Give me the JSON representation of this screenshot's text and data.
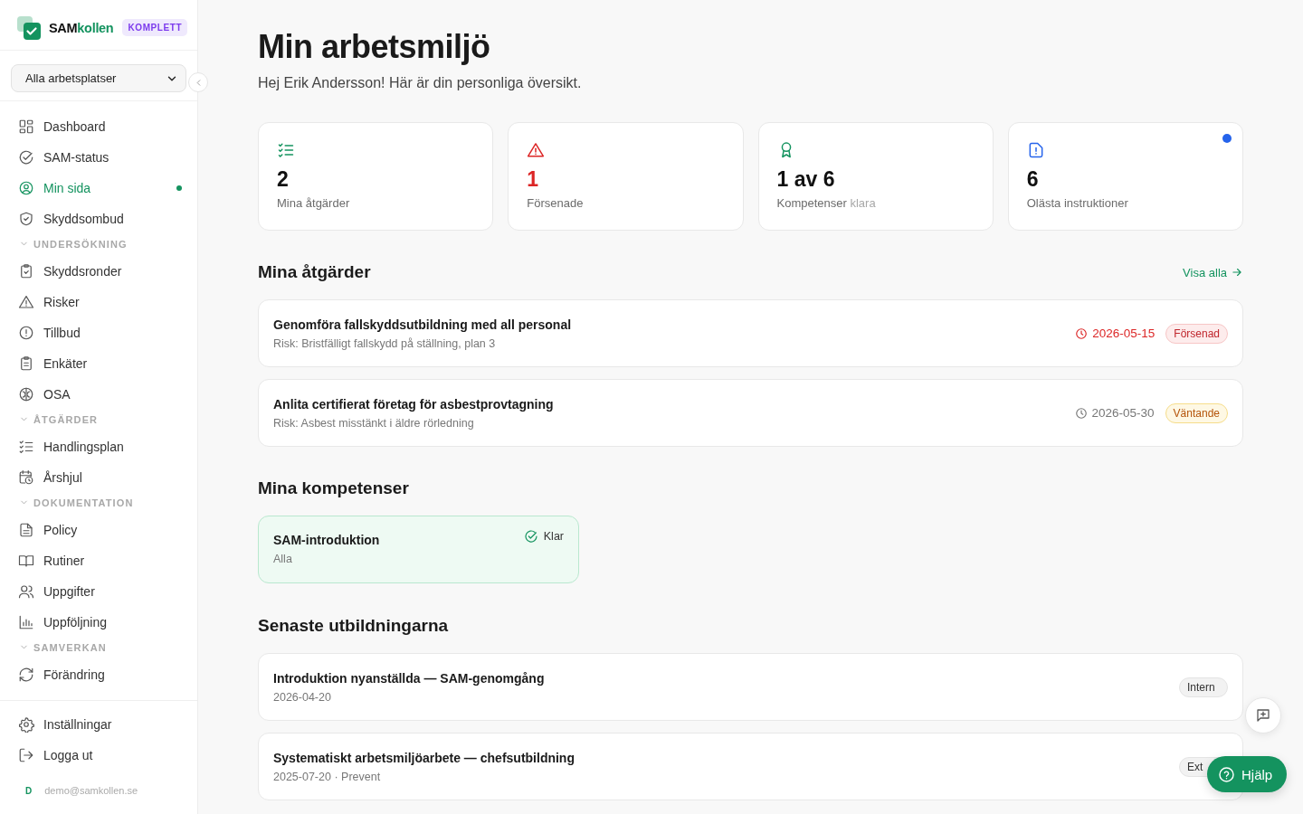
{
  "brand": {
    "name_main": "SAM",
    "name_accent": "kollen",
    "plan": "KOMPLETT"
  },
  "workplace_select": {
    "value": "Alla arbetsplatser"
  },
  "sidebar": {
    "sections": [
      {
        "items": [
          {
            "label": "Dashboard",
            "selected": false,
            "unread": false
          },
          {
            "label": "SAM-status",
            "selected": false,
            "unread": false
          },
          {
            "label": "Min sida",
            "selected": true,
            "unread": true
          },
          {
            "label": "Skyddsombud",
            "selected": false,
            "unread": false
          }
        ]
      },
      {
        "heading": "UNDERSÖKNING",
        "expanded": true,
        "items": [
          {
            "label": "Skyddsronder",
            "selected": false,
            "unread": false
          },
          {
            "label": "Risker",
            "selected": false,
            "unread": false
          },
          {
            "label": "Tillbud",
            "selected": false,
            "unread": false
          },
          {
            "label": "Enkäter",
            "selected": false,
            "unread": false
          },
          {
            "label": "OSA",
            "selected": false,
            "unread": false
          }
        ]
      },
      {
        "heading": "ÅTGÄRDER",
        "expanded": true,
        "items": [
          {
            "label": "Handlingsplan",
            "selected": false,
            "unread": false
          },
          {
            "label": "Årshjul",
            "selected": false,
            "unread": false
          }
        ]
      },
      {
        "heading": "DOKUMENTATION",
        "expanded": true,
        "items": [
          {
            "label": "Policy",
            "selected": false,
            "unread": false
          },
          {
            "label": "Rutiner",
            "selected": false,
            "unread": false
          },
          {
            "label": "Uppgifter",
            "selected": false,
            "unread": false
          },
          {
            "label": "Uppföljning",
            "selected": false,
            "unread": false
          }
        ]
      },
      {
        "heading": "SAMVERKAN",
        "expanded": true,
        "items": [
          {
            "label": "Förändring",
            "selected": false,
            "unread": false
          }
        ]
      }
    ],
    "footer": [
      {
        "label": "Inställningar"
      },
      {
        "label": "Logga ut"
      }
    ],
    "user": {
      "initial": "D",
      "email": "demo@samkollen.se"
    }
  },
  "page": {
    "title": "Min arbetsmiljö",
    "subtitle": "Hej Erik Andersson! Här är din personliga översikt."
  },
  "stats": [
    {
      "kind": "tasks",
      "value": "2",
      "label": "Mina åtgärder",
      "unread": false
    },
    {
      "kind": "overdue",
      "value": "1",
      "label": "Försenade",
      "unread": false
    },
    {
      "kind": "competence",
      "value": "1 av 6",
      "label": "Kompetenser",
      "label_suffix": "klara",
      "unread": false
    },
    {
      "kind": "instructions",
      "value": "6",
      "label": "Olästa instruktioner",
      "unread": true
    }
  ],
  "actions": {
    "heading": "Mina åtgärder",
    "link": "Visa alla",
    "items": [
      {
        "kind": "overdue",
        "title": "Genomföra fallskyddsutbildning med all personal",
        "subtitle": "Risk: Bristfälligt fallskydd på ställning, plan 3",
        "date": "2026-05-15",
        "status": "Försenad"
      },
      {
        "kind": "pending",
        "title": "Anlita certifierat företag för asbestprovtagning",
        "subtitle": "Risk: Asbest misstänkt i äldre rörledning",
        "date": "2026-05-30",
        "status": "Väntande"
      }
    ]
  },
  "competences": {
    "heading": "Mina kompetenser",
    "items": [
      {
        "title": "SAM-introduktion",
        "subtitle": "Alla",
        "status": "Klar",
        "done": true
      }
    ]
  },
  "trainings": {
    "heading": "Senaste utbildningarna",
    "items": [
      {
        "title": "Introduktion nyanställda — SAM-genomgång",
        "subtitle": "2026-04-20",
        "tag": "Intern"
      },
      {
        "title": "Systematiskt arbetsmiljöarbete — chefsutbildning",
        "subtitle": "2025-07-20 · Prevent",
        "tag": "Ext"
      }
    ]
  },
  "help_button": {
    "label": "Hjälp"
  }
}
